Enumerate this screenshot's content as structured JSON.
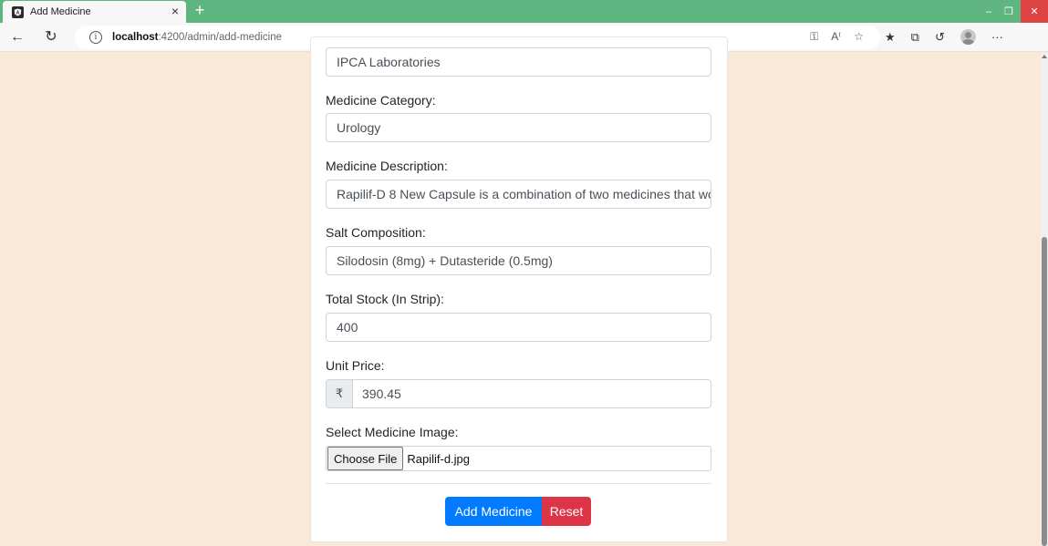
{
  "browser": {
    "tab_title": "Add Medicine",
    "tab_close": "×",
    "new_tab": "+",
    "url_host": "localhost",
    "url_rest": ":4200/admin/add-medicine",
    "more_menu": "···"
  },
  "form": {
    "manufacturer_value": "IPCA Laboratories",
    "category_label": "Medicine Category:",
    "category_value": "Urology",
    "description_label": "Medicine Description:",
    "description_value": "Rapilif-D 8 New Capsule is a combination of two medicines that wo",
    "salt_label": "Salt Composition:",
    "salt_value": "Silodosin (8mg) + Dutasteride (0.5mg)",
    "stock_label": "Total Stock (In Strip):",
    "stock_value": "400",
    "price_label": "Unit Price:",
    "price_currency": "₹",
    "price_value": "390.45",
    "image_label": "Select Medicine Image:",
    "choose_file_label": "Choose File",
    "file_name": "Rapilif-d.jpg",
    "submit_label": "Add Medicine",
    "reset_label": "Reset"
  },
  "colors": {
    "page_bg": "#f9e9d6",
    "tab_bar": "#5fb57f",
    "primary": "#007bff",
    "danger": "#dc3545"
  }
}
